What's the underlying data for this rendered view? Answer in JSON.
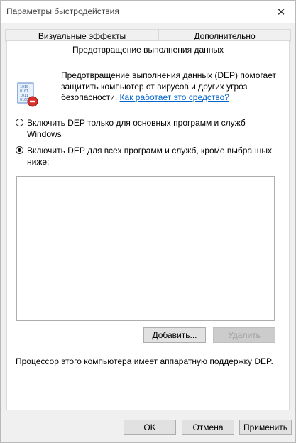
{
  "window": {
    "title": "Параметры быстродействия",
    "close_glyph": "✕"
  },
  "tabs": [
    {
      "label": "Визуальные эффекты"
    },
    {
      "label": "Дополнительно"
    },
    {
      "label": "Предотвращение выполнения данных"
    }
  ],
  "dep": {
    "icon": "dep-shield-icon",
    "description": "Предотвращение выполнения данных (DEP) помогает защитить компьютер от вирусов и других угроз безопасности.",
    "help_link": "Как работает это средство?",
    "option_essential": "Включить DEP только для основных программ и служб Windows",
    "option_all": "Включить DEP для всех программ и служб, кроме выбранных ниже:",
    "selected_option": "all",
    "add_button": "Добавить...",
    "remove_button": "Удалить",
    "status": "Процессор этого компьютера имеет аппаратную поддержку DEP."
  },
  "footer": {
    "ok": "OK",
    "cancel": "Отмена",
    "apply": "Применить"
  }
}
